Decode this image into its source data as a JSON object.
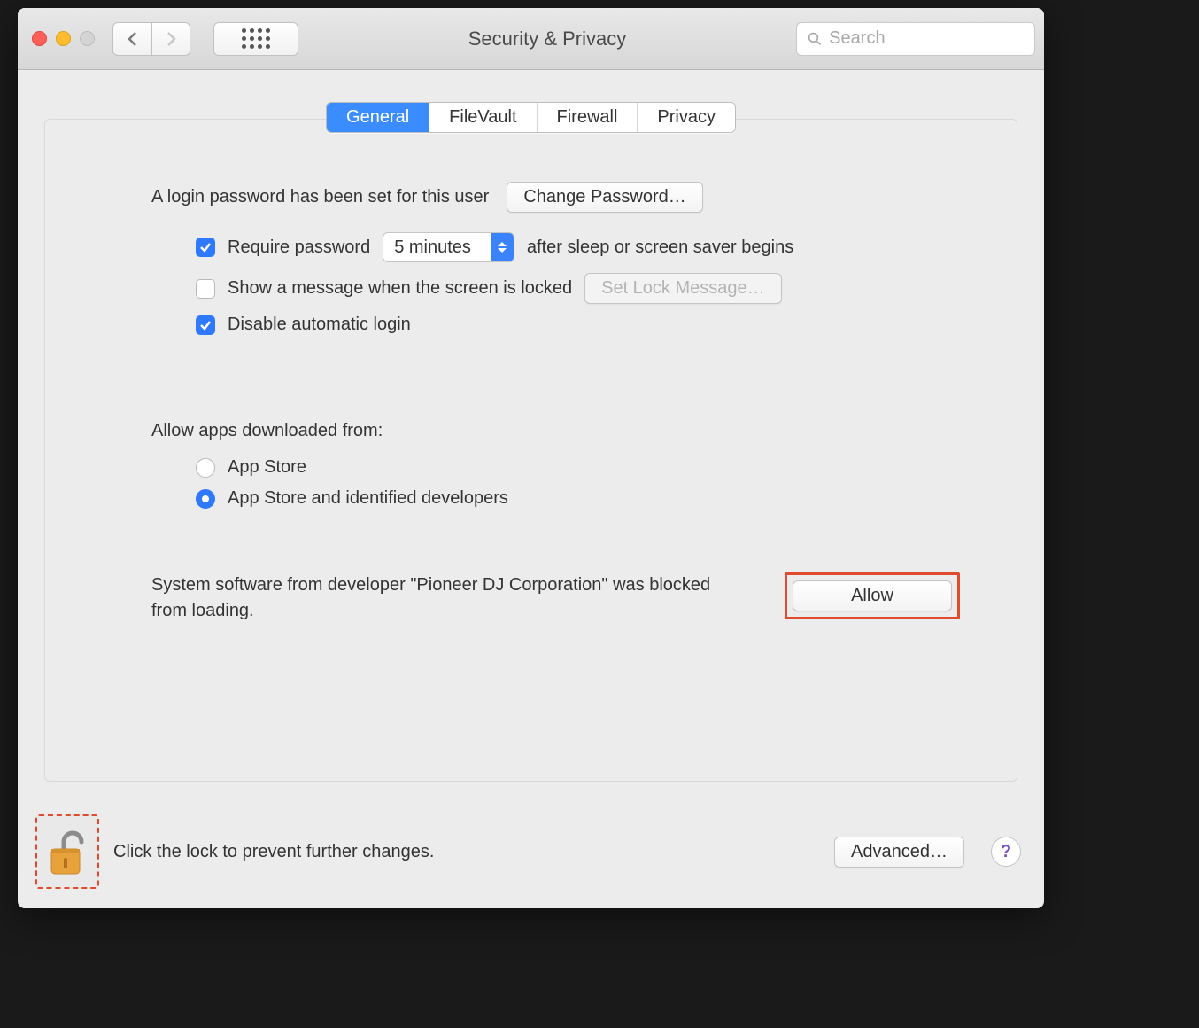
{
  "window": {
    "title": "Security & Privacy"
  },
  "search": {
    "placeholder": "Search"
  },
  "tabs": [
    "General",
    "FileVault",
    "Firewall",
    "Privacy"
  ],
  "login": {
    "text": "A login password has been set for this user",
    "change_btn": "Change Password…"
  },
  "require_pw": {
    "label_before": "Require password",
    "delay": "5 minutes",
    "label_after": "after sleep or screen saver begins",
    "checked": true
  },
  "lock_msg": {
    "label": "Show a message when the screen is locked",
    "btn": "Set Lock Message…",
    "checked": false
  },
  "disable_auto": {
    "label": "Disable automatic login",
    "checked": true
  },
  "allow_apps": {
    "title": "Allow apps downloaded from:",
    "opt1": "App Store",
    "opt2": "App Store and identified developers",
    "selected": 1
  },
  "blocked": {
    "text": "System software from developer \"Pioneer DJ Corporation\" was blocked from loading.",
    "btn": "Allow"
  },
  "footer": {
    "lock_text": "Click the lock to prevent further changes.",
    "advanced": "Advanced…",
    "help": "?"
  }
}
